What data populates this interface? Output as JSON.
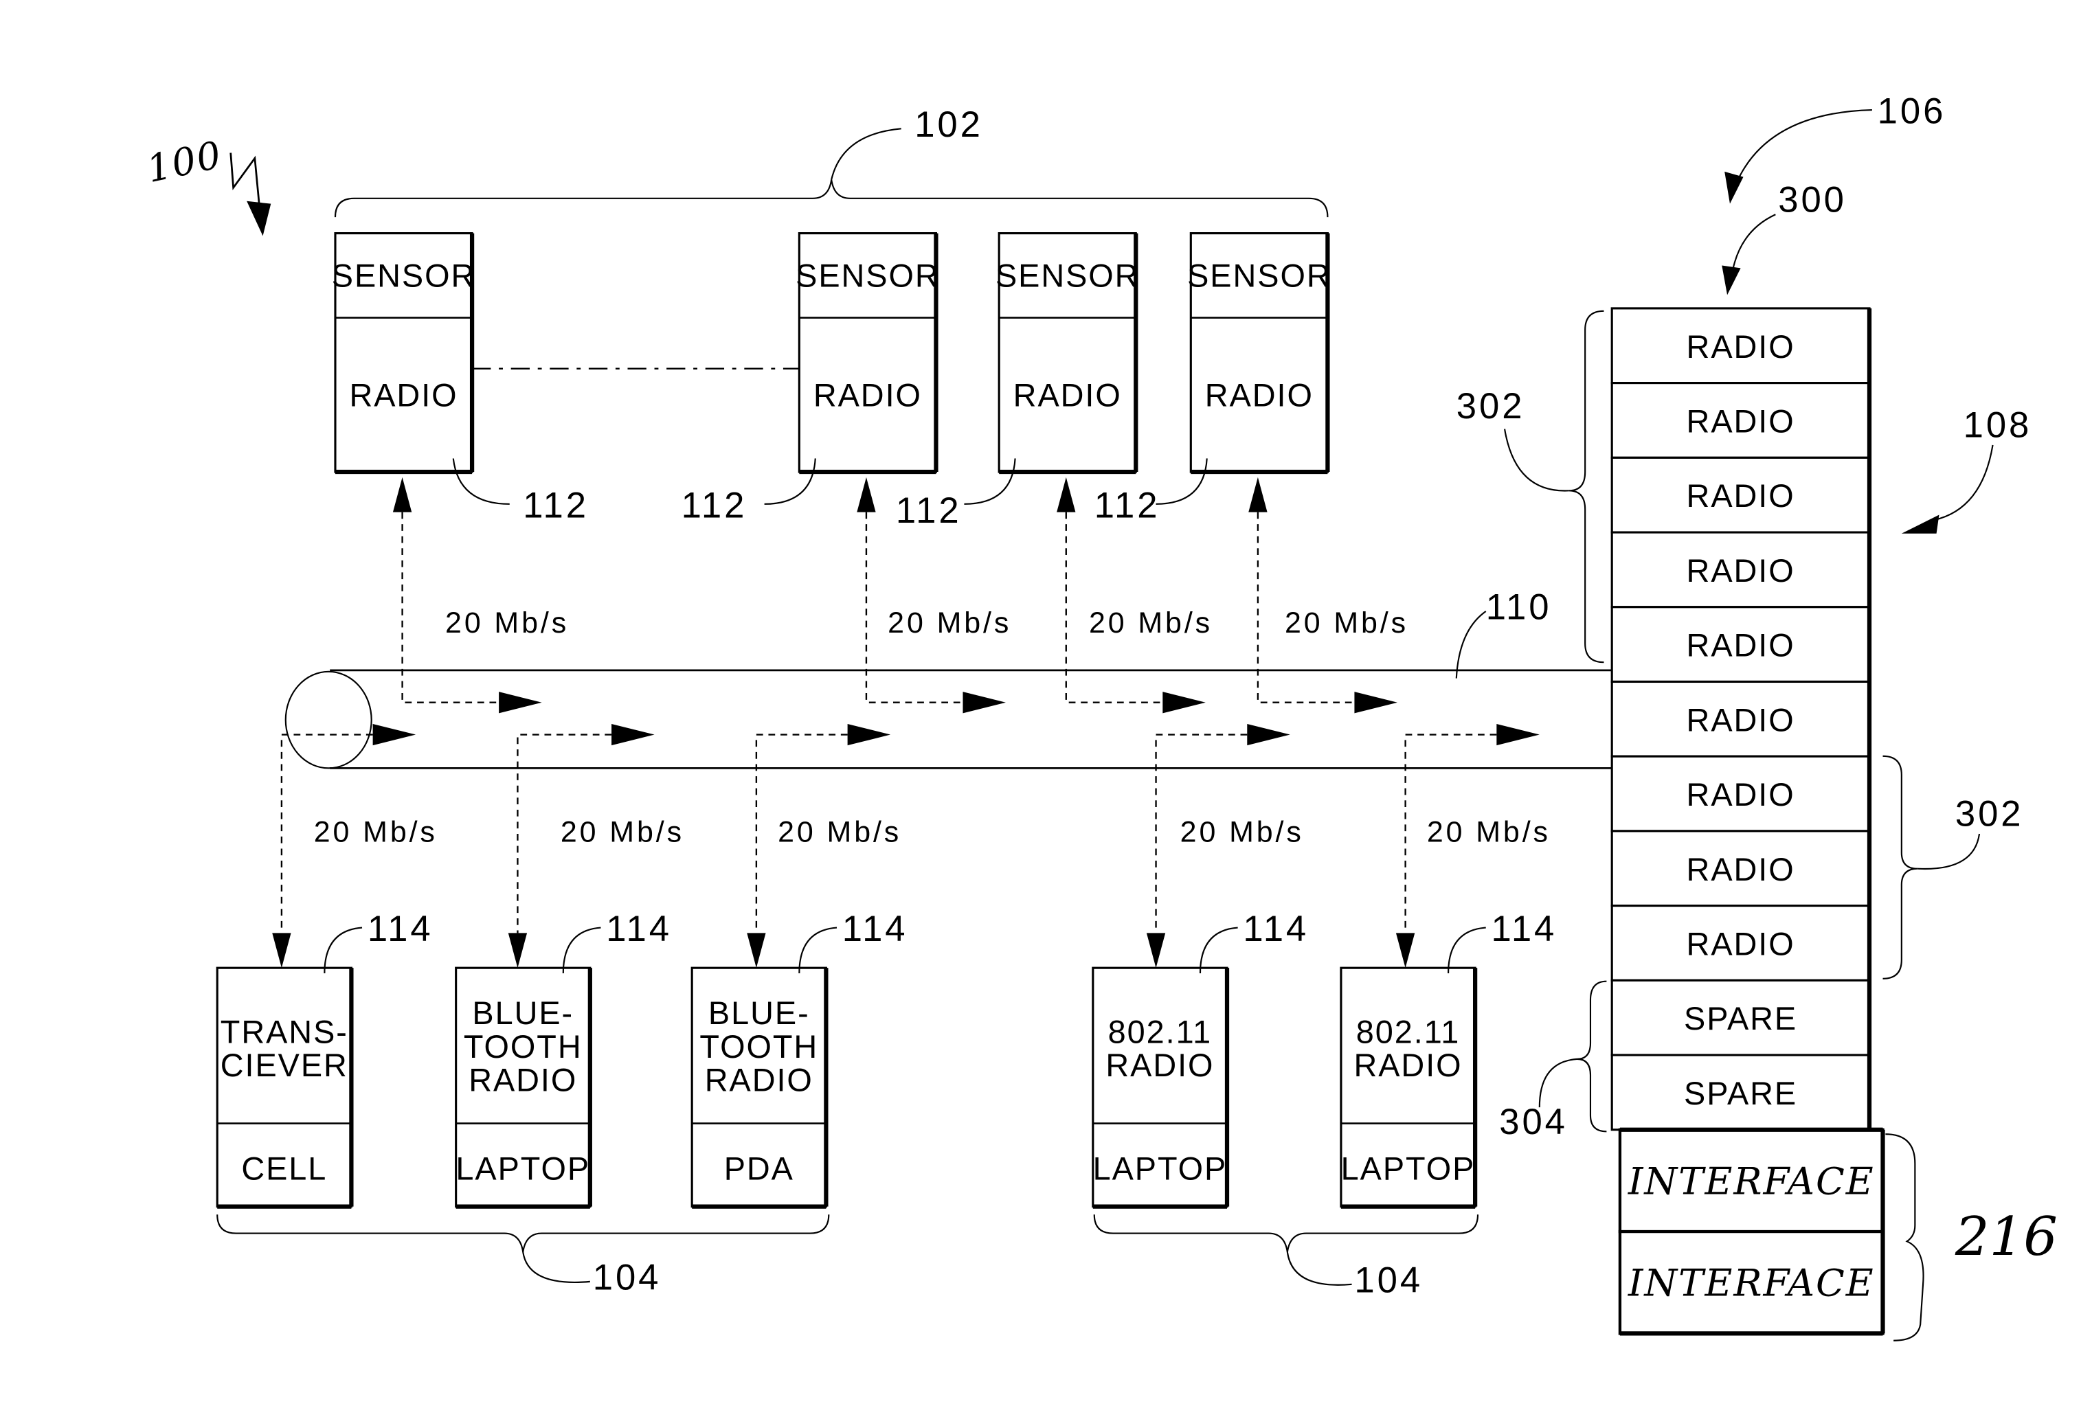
{
  "figure": {
    "system_ref": "100",
    "sensor_group_ref": "102",
    "device_group_ref": "104",
    "base_station_ref": "106",
    "stack_arrow_ref": "108",
    "bus_ref": "110",
    "stack_ref": "300",
    "interface_group_ref": "216"
  },
  "sensors": [
    {
      "top": "SENSOR",
      "bottom": "RADIO",
      "ref": "112",
      "rate": "20 Mb/s"
    },
    {
      "top": "SENSOR",
      "bottom": "RADIO",
      "ref": "112",
      "rate": "20 Mb/s"
    },
    {
      "top": "SENSOR",
      "bottom": "RADIO",
      "ref": "112",
      "rate": "20 Mb/s"
    },
    {
      "top": "SENSOR",
      "bottom": "RADIO",
      "ref": "112",
      "rate": "20 Mb/s"
    }
  ],
  "devices": [
    {
      "top_lines": [
        "TRANS-",
        "CIEVER"
      ],
      "bottom": "CELL",
      "ref": "114",
      "rate": "20 Mb/s"
    },
    {
      "top_lines": [
        "BLUE-",
        "TOOTH",
        "RADIO"
      ],
      "bottom": "LAPTOP",
      "ref": "114",
      "rate": "20 Mb/s"
    },
    {
      "top_lines": [
        "BLUE-",
        "TOOTH",
        "RADIO"
      ],
      "bottom": "PDA",
      "ref": "114",
      "rate": "20 Mb/s"
    },
    {
      "top_lines": [
        "802.11",
        "RADIO"
      ],
      "bottom": "LAPTOP",
      "ref": "114",
      "rate": "20 Mb/s"
    },
    {
      "top_lines": [
        "802.11",
        "RADIO"
      ],
      "bottom": "LAPTOP",
      "ref": "114",
      "rate": "20 Mb/s"
    }
  ],
  "stack": {
    "cells": [
      "RADIO",
      "RADIO",
      "RADIO",
      "RADIO",
      "RADIO",
      "RADIO",
      "RADIO",
      "RADIO",
      "RADIO",
      "SPARE",
      "SPARE"
    ],
    "interfaces": [
      "INTERFACE",
      "INTERFACE"
    ],
    "upper_radio_group_ref": "302",
    "lower_radio_group_ref": "302",
    "spare_group_ref": "304"
  }
}
